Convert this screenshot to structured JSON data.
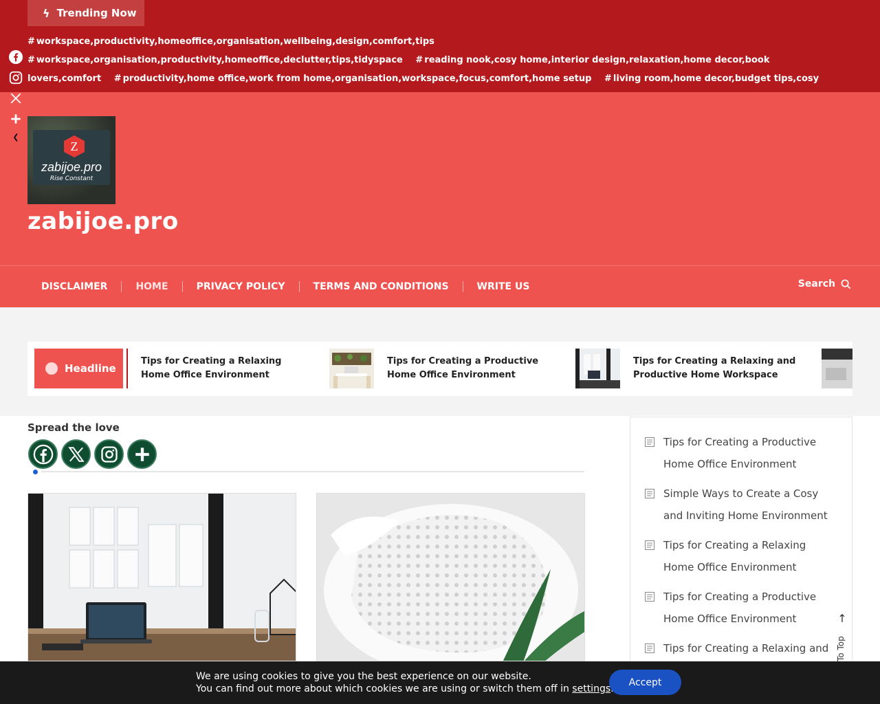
{
  "trending": {
    "label": "Trending Now",
    "tags": [
      "workspace,productivity,homeoffice,organisation,wellbeing,design,comfort,tips",
      "workspace,organisation,productivity,homeoffice,declutter,tips,tidyspace",
      "reading nook,cosy home,interior design,relaxation,home decor,book lovers,comfort",
      "productivity,home office,work from home,organisation,workspace,focus,comfort,home setup",
      "living room,home decor,budget tips,cosy home,interior design,decorating ideas,small space"
    ]
  },
  "header": {
    "logo_text": "zabijoe.pro",
    "logo_tagline": "Rise Constant",
    "logo_letter": "Z",
    "site_title": "zabijoe.pro"
  },
  "nav": {
    "items": [
      "DISCLAIMER",
      "HOME",
      "PRIVACY POLICY",
      "TERMS AND CONDITIONS",
      "WRITE US"
    ],
    "active": "HOME",
    "search_label": "Search"
  },
  "share_side": [
    "facebook-icon",
    "instagram-icon",
    "x-icon",
    "plus-icon"
  ],
  "ticker": {
    "label": "Headline",
    "items": [
      "Tips for Creating a Relaxing Home Office Environment",
      "Tips for Creating a Productive Home Office Environment",
      "Tips for Creating a Relaxing and Productive Home Workspace"
    ]
  },
  "content": {
    "spread_label": "Spread the love"
  },
  "sidebar": {
    "recent_posts": [
      "Tips for Creating a Productive Home Office Environment",
      "Simple Ways to Create a Cosy and Inviting Home Environment",
      "Tips for Creating a Relaxing Home Office Environment",
      "Tips for Creating a Productive Home Office Environment",
      "Tips for Creating a Relaxing and"
    ]
  },
  "to_top": {
    "label": "To Top"
  },
  "cookie": {
    "line1": "We are using cookies to give you the best experience on our website.",
    "line2_prefix": "You can find out more about which cookies we are using or switch them off in",
    "settings_link": "settings",
    "line2_suffix": ".",
    "accept_label": "Accept"
  },
  "colors": {
    "trend_bar": "#b3191d",
    "header": "#ef5350",
    "social_green": "#0f4d30",
    "accept_blue": "#1a52c4"
  }
}
